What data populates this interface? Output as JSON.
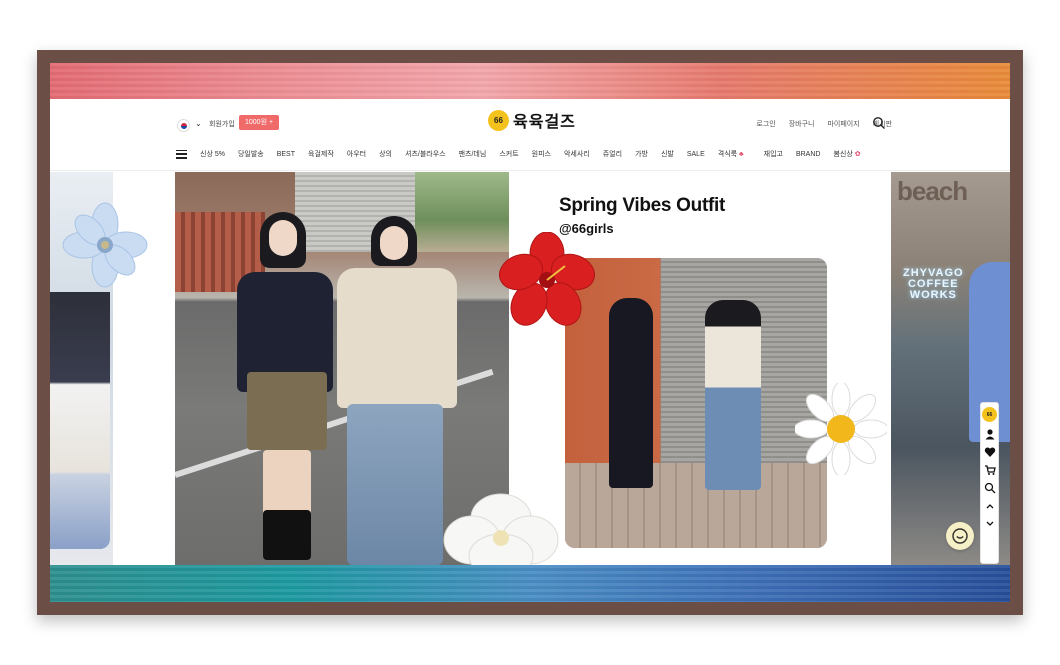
{
  "header": {
    "join_label": "회원가입",
    "join_badge": "1000원 +",
    "logo_mark": "66",
    "logo_text": "육육걸즈",
    "util_links": [
      "로그인",
      "장바구니",
      "마이페이지",
      "게시판"
    ]
  },
  "nav": {
    "items": [
      "신상 5%",
      "당일발송",
      "BEST",
      "육걸제작",
      "아우터",
      "상의",
      "셔츠/블라우스",
      "팬츠/데님",
      "스커트",
      "원피스",
      "악세사리",
      "쥬얼리",
      "가방",
      "신발",
      "SALE",
      "격식룩",
      "재입고",
      "BRAND",
      "봄신상"
    ]
  },
  "banner": {
    "title": "Spring Vibes Outfit",
    "handle": "@66girls",
    "side_text": "beach",
    "neon_text": [
      "ZHYVAGO",
      "COFFEE",
      "WORKS"
    ]
  },
  "quickbar": {
    "logo_mark": "66",
    "icons": [
      "user-icon",
      "heart-icon",
      "cart-icon",
      "search-icon",
      "arrow-up-icon",
      "arrow-down-icon"
    ]
  },
  "colors": {
    "badge": "#f06a6a",
    "logo_yellow": "#f4c21c",
    "frame": "#6b4e45"
  }
}
